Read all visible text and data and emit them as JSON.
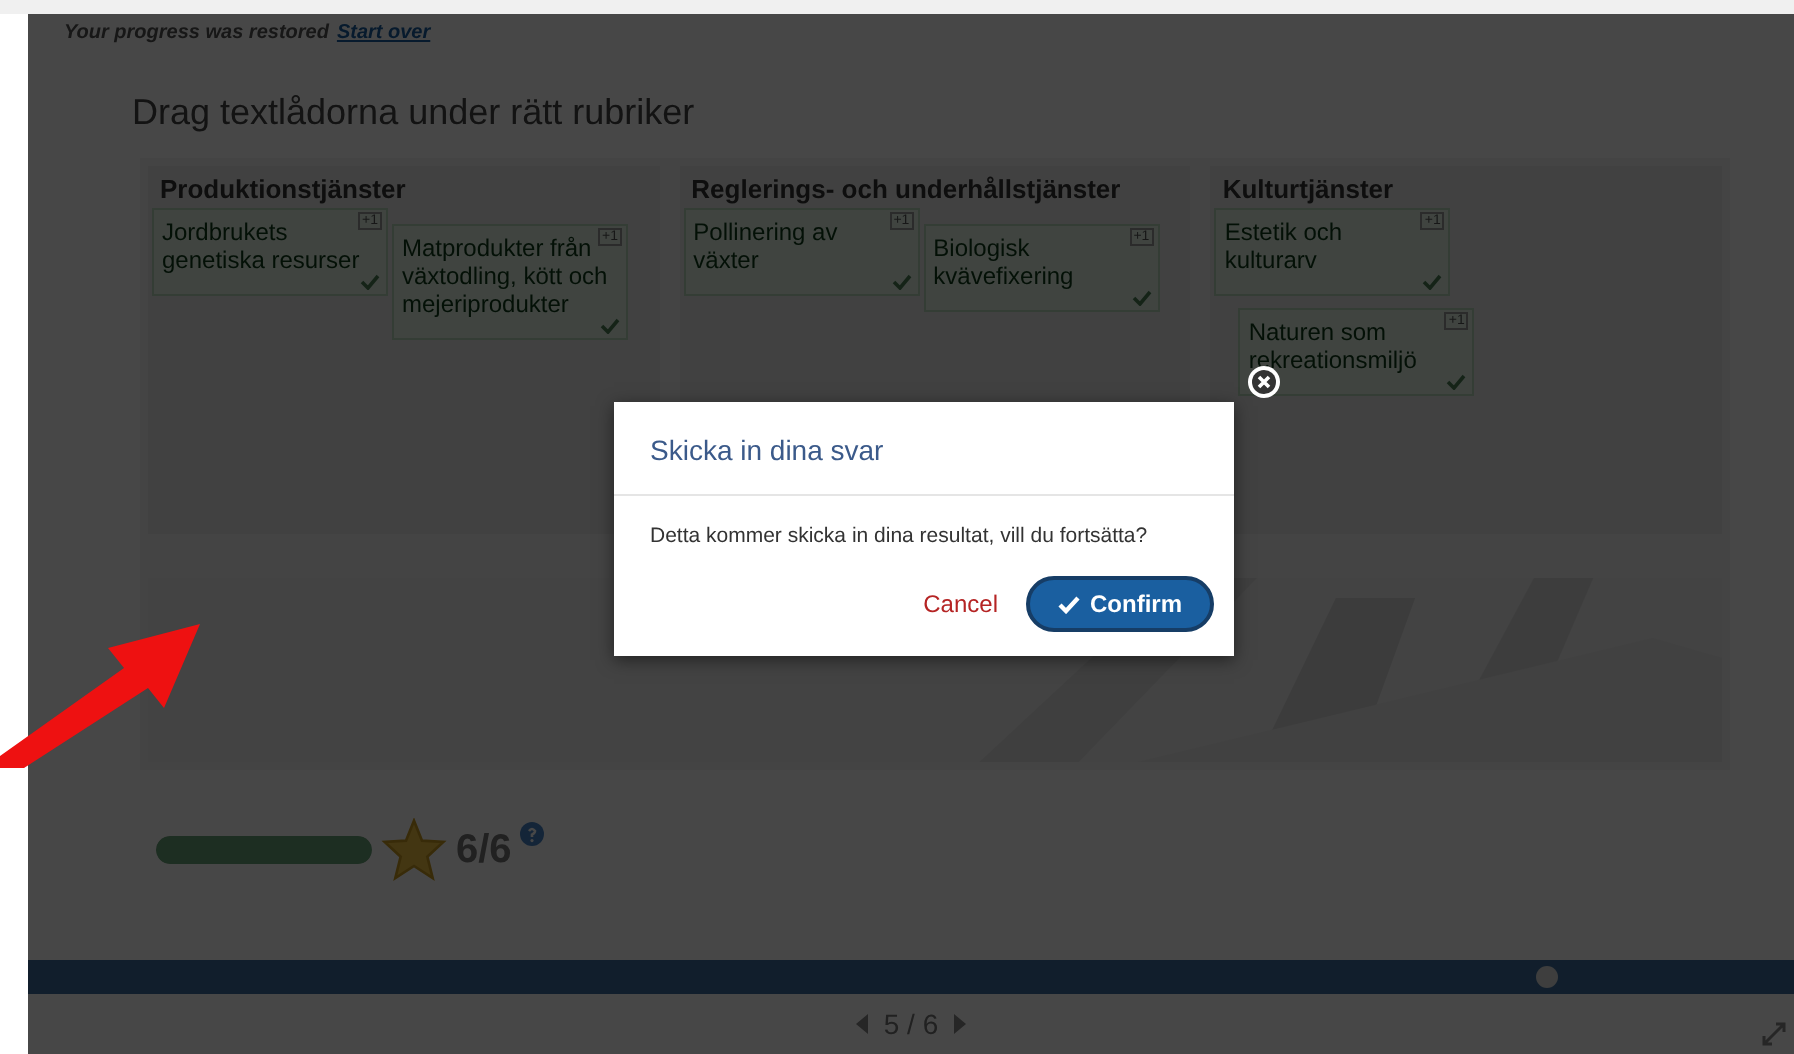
{
  "notice": {
    "text": "Your progress was restored",
    "link": "Start over"
  },
  "title": "Drag textlådorna under rätt rubriker",
  "columns": [
    {
      "heading": "Produktionstjänster",
      "cards": [
        {
          "text": "Jordbrukets genetiska resurser",
          "badge": "+1"
        },
        {
          "text": "Matprodukter från växtodling, kött och mejeriprodukter",
          "badge": "+1"
        }
      ]
    },
    {
      "heading": "Reglerings- och underhållstjänster",
      "cards": [
        {
          "text": "Pollinering av växter",
          "badge": "+1"
        },
        {
          "text": "Biologisk kvävefixering",
          "badge": "+1"
        }
      ]
    },
    {
      "heading": "Kulturtjänster",
      "cards": [
        {
          "text": "Estetik och kulturarv",
          "badge": "+1"
        },
        {
          "text": "Naturen som rekreationsmiljö",
          "badge": "+1"
        }
      ]
    }
  ],
  "score": {
    "level": 1,
    "text": "6/6"
  },
  "timeline": {
    "level": 0.86
  },
  "pagination": {
    "text": "5 / 6"
  },
  "dialog": {
    "title": "Skicka in dina svar",
    "message": "Detta kommer skicka in dina resultat, vill du fortsätta?",
    "cancel": "Cancel",
    "confirm": "Confirm"
  }
}
